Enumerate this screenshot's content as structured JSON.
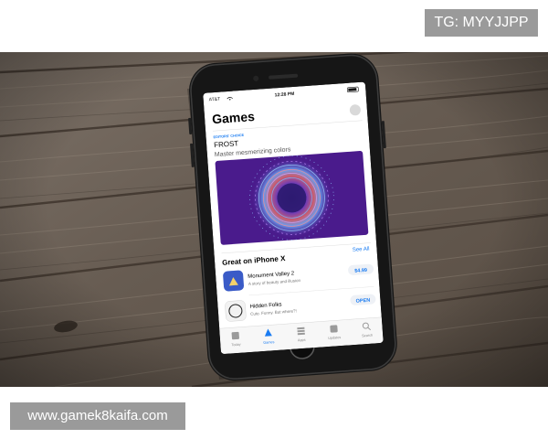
{
  "overlay": {
    "tg_label": "TG: MYYJJPP",
    "site_label": "www.gamek8kaifa.com"
  },
  "phone": {
    "status": {
      "carrier": "AT&T",
      "time": "12:28 PM"
    },
    "app": {
      "title": "Games",
      "featured": {
        "eyebrow": "EDITORS' CHOICE",
        "name": "FROST",
        "tagline": "Master mesmerizing colors"
      },
      "section": {
        "title": "Great on iPhone X",
        "see_all": "See All",
        "items": [
          {
            "name": "Monument Valley 2",
            "subtitle": "A story of beauty and illusion",
            "action": "$4.99"
          },
          {
            "name": "Hidden Folks",
            "subtitle": "Cute. Funny. But where?!",
            "action": "OPEN"
          }
        ]
      },
      "tabs": [
        "Today",
        "Games",
        "Apps",
        "Updates",
        "Search"
      ]
    }
  },
  "colors": {
    "accent": "#1a7cf2",
    "wood_dark": "#4a4037",
    "wood_light": "#8a7e70",
    "frost_bg": "#4a1b8c"
  }
}
